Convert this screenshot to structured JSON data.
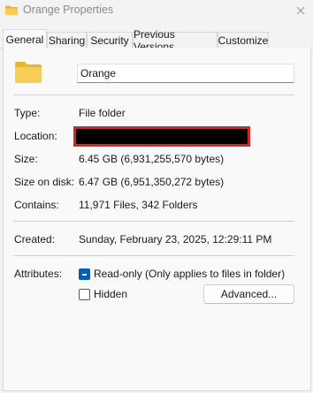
{
  "window": {
    "title": "Orange Properties",
    "close_glyph": "✕"
  },
  "tabs": [
    {
      "label": "General",
      "active": true
    },
    {
      "label": "Sharing",
      "active": false
    },
    {
      "label": "Security",
      "active": false
    },
    {
      "label": "Previous Versions",
      "active": false
    },
    {
      "label": "Customize",
      "active": false
    }
  ],
  "general": {
    "folder_name": "Orange",
    "type_label": "Type:",
    "type_value": "File folder",
    "location_label": "Location:",
    "location_redacted": true,
    "size_label": "Size:",
    "size_value": "6.45 GB (6,931,255,570 bytes)",
    "size_on_disk_label": "Size on disk:",
    "size_on_disk_value": "6.47 GB (6,951,350,272 bytes)",
    "contains_label": "Contains:",
    "contains_value": "11,971 Files, 342 Folders",
    "created_label": "Created:",
    "created_value": "Sunday, February 23, 2025, 12:29:11 PM",
    "attributes_label": "Attributes:",
    "readonly_label": "Read-only (Only applies to files in folder)",
    "readonly_state": "indeterminate",
    "hidden_label": "Hidden",
    "hidden_checked": false,
    "advanced_button": "Advanced..."
  },
  "colors": {
    "accent": "#005fb8",
    "folder": "#f2c548",
    "redaction_border": "#e02020"
  },
  "icons": {
    "title": "folder-icon",
    "folder_large": "folder-icon",
    "close": "close-icon"
  }
}
